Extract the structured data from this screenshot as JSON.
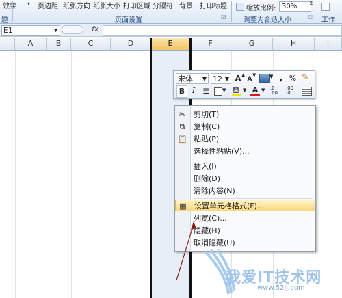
{
  "ribbon": {
    "items": [
      "效果",
      "页边距",
      "纸张方向",
      "纸张大小",
      "打印区域",
      "分隔符",
      "背景",
      "打印标题"
    ],
    "group_theme": "题",
    "group_page_setup": "页面设置",
    "scale_label": "缩放比例:",
    "scale_value": "30%",
    "group_fit": "调整为合适大小",
    "group_sheet": "工作"
  },
  "formula_bar": {
    "cell_ref": "E1",
    "fx": "fx",
    "value": ""
  },
  "columns": [
    "A",
    "B",
    "C",
    "D",
    "E",
    "F",
    "G",
    "H",
    "I"
  ],
  "selected_column": "E",
  "mini_toolbar": {
    "font": "宋体",
    "size": "12",
    "increase_font": "A",
    "decrease_font": "A",
    "percent": "%",
    "comma": ",",
    "bold": "B",
    "italic": "I",
    "font_color": "A",
    "inc_decimal": ".0 .00",
    "dec_decimal": ".00 .0"
  },
  "context_menu": {
    "items": [
      {
        "label": "剪切(T)",
        "icon": "scissors-icon"
      },
      {
        "label": "复制(C)",
        "icon": "copy-icon"
      },
      {
        "label": "粘贴(P)",
        "icon": "paste-icon"
      },
      {
        "label": "选择性粘贴(V)...",
        "icon": ""
      },
      {
        "label": "插入(I)",
        "icon": ""
      },
      {
        "label": "删除(D)",
        "icon": ""
      },
      {
        "label": "清除内容(N)",
        "icon": ""
      },
      {
        "label": "设置单元格格式(F)...",
        "icon": "format-cells-icon"
      },
      {
        "label": "列宽(C)...",
        "icon": ""
      },
      {
        "label": "隐藏(H)",
        "icon": ""
      },
      {
        "label": "取消隐藏(U)",
        "icon": ""
      }
    ]
  },
  "watermark": {
    "text": "我爱IT技术网",
    "url": "www.52ij.com"
  },
  "colors": {
    "highlight": "#fbd97c",
    "selected_col": "#e8eef7",
    "accent": "#2a4a78"
  }
}
